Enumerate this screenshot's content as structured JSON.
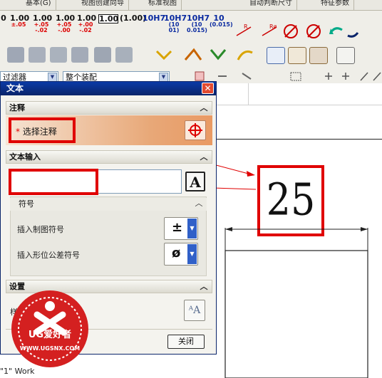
{
  "top_tabs": [
    "基本(G)",
    "视图创建向导",
    "标准视图",
    "自动判断尺寸",
    "特征参数"
  ],
  "tolerance_buttons": [
    {
      "top": "1.00",
      "sub": "±.05"
    },
    {
      "top": "1.00",
      "sub": "+.05 -.02"
    },
    {
      "top": "1.00",
      "sub": "+.05 -.00"
    },
    {
      "top": "1.00",
      "sub": "+.00 -.02"
    },
    {
      "top": "1.00",
      "sub": ""
    },
    {
      "top": "(1.00)",
      "sub": ""
    },
    {
      "top": "10H7",
      "sub": ""
    },
    {
      "top": "10H7",
      "sub": "(10 01)"
    },
    {
      "top": "10H7",
      "sub": "(10 0.015)"
    },
    {
      "top": "10",
      "sub": "(0.015)"
    }
  ],
  "filter_combo": "过滤器",
  "assembly_combo": "整个装配",
  "dialog": {
    "title": "文本",
    "annotation_section": "注释",
    "select_annotation": "选择注释",
    "text_input_section": "文本输入",
    "text_value": "",
    "symbols_section": "符号",
    "insert_drafting_symbol": "插入制图符号",
    "drafting_symbol_value": "±",
    "insert_gdt_symbol": "插入形位公差符号",
    "gdt_symbol_value": "ø",
    "settings_section": "设置",
    "style_label": "样式",
    "close_button": "关闭"
  },
  "dimension_value": "25",
  "watermark": {
    "brand": "UG爱好者",
    "url": "WWW.UGSNX.COM"
  },
  "bottom_label": "\"1\" Work",
  "colors": {
    "accent_red": "#e00000",
    "title_blue": "#0a246a"
  }
}
